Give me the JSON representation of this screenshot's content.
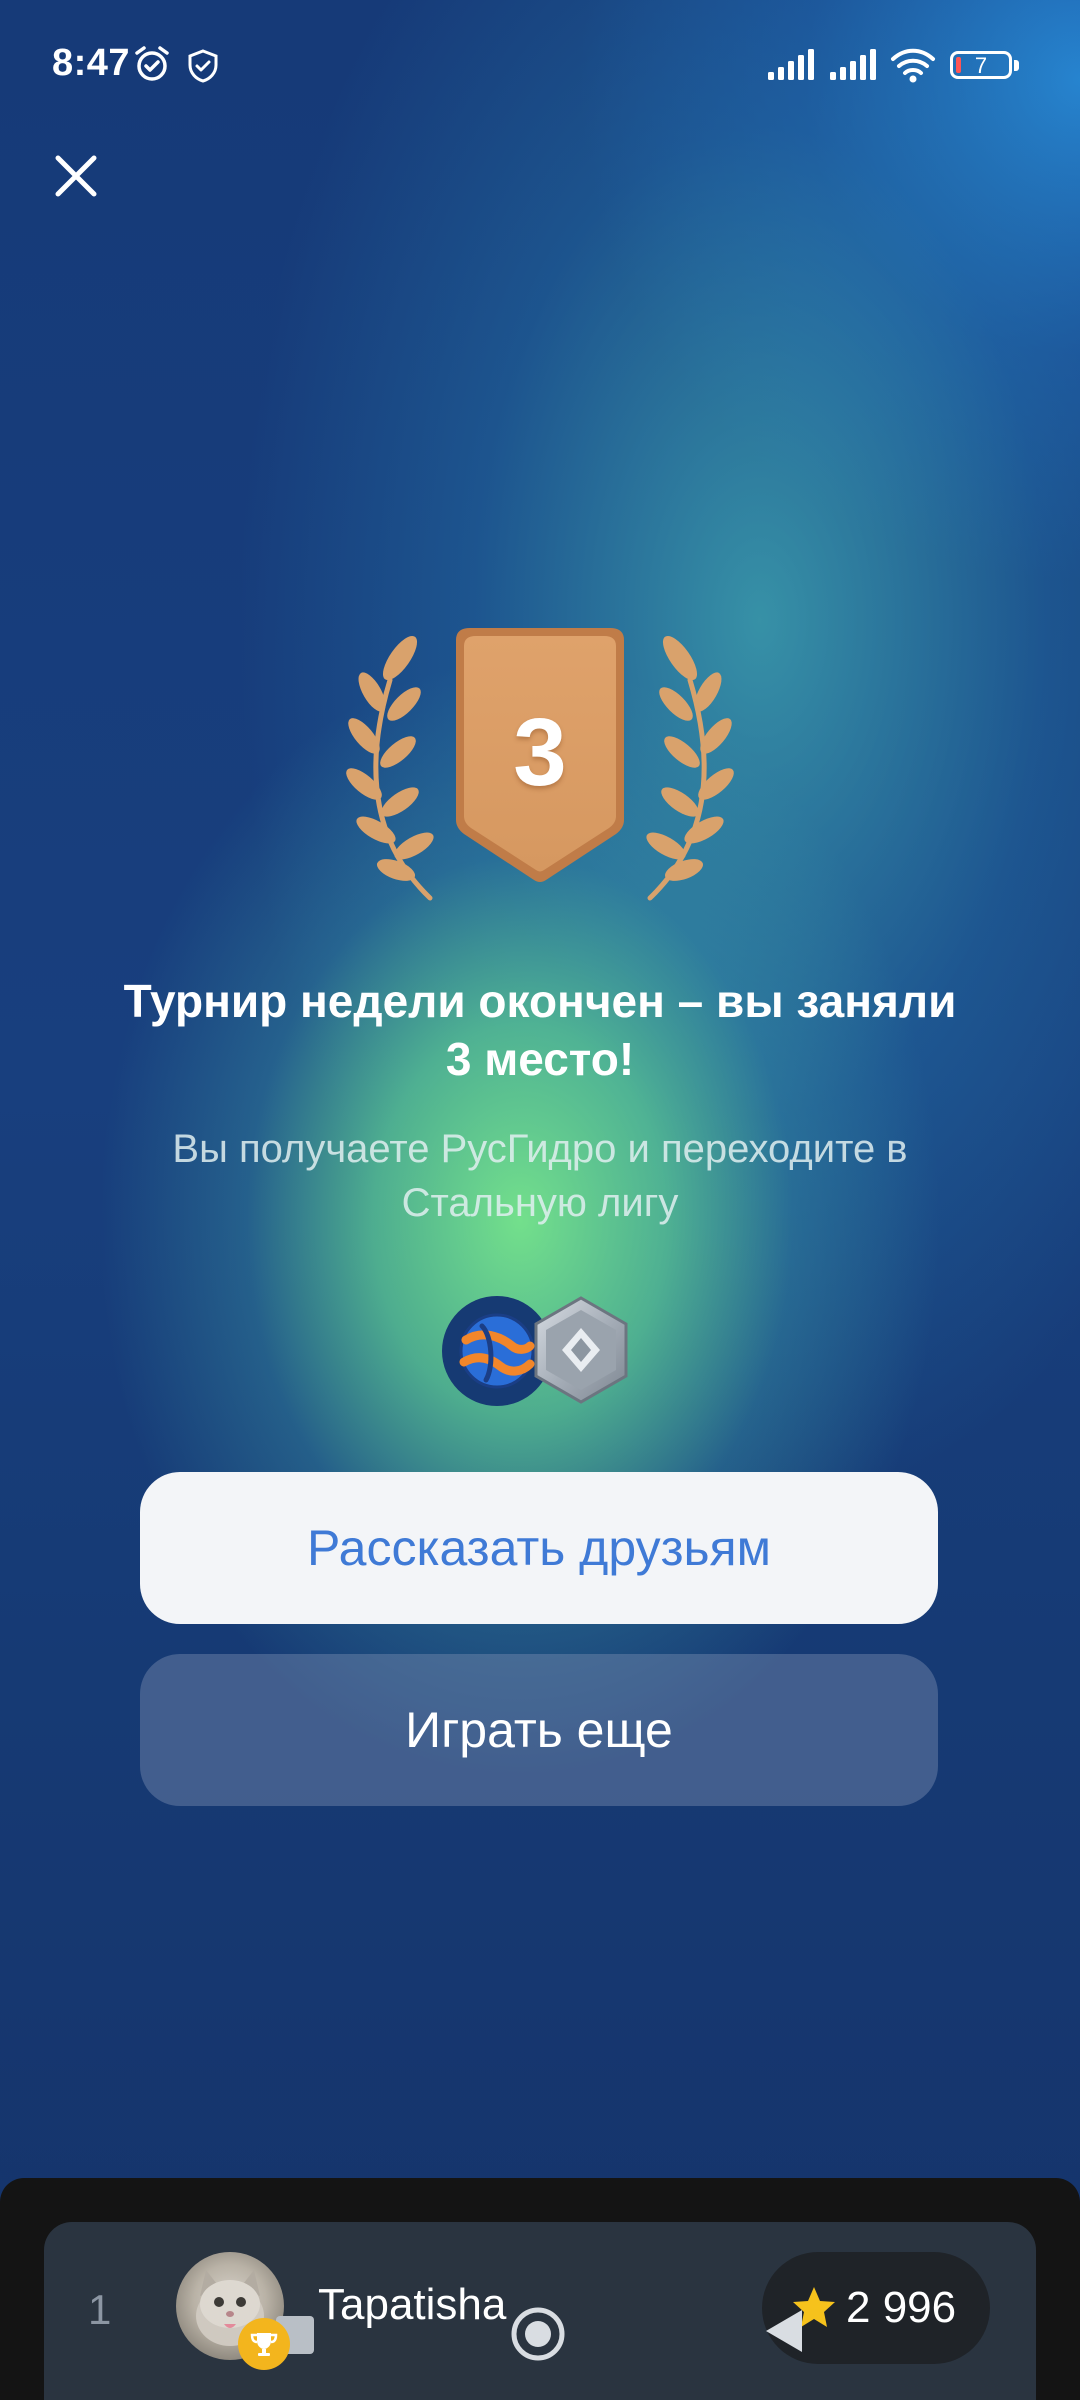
{
  "status_bar": {
    "time": "8:47",
    "battery_level": "7",
    "icons": [
      "alarm-icon",
      "shield-check-icon",
      "signal-icon",
      "signal-icon",
      "wifi-icon",
      "battery-icon"
    ]
  },
  "close_icon": "close-icon",
  "medal": {
    "place": "3",
    "colors": {
      "medal": "#d89a62",
      "laurel": "#d8a06a"
    }
  },
  "result": {
    "title": "Турнир недели окончен – вы заняли 3 место!",
    "subtitle": "Вы получаете РусГидро и переходите в Стальную лигу"
  },
  "rewards": {
    "icons": [
      "rushydro-logo-icon",
      "steel-league-icon"
    ]
  },
  "buttons": {
    "share": "Рассказать друзьям",
    "play_again": "Играть еще"
  },
  "leaderboard": {
    "rank": "1",
    "name": "Tapatisha",
    "score": "2 996",
    "badge_icon": "trophy-icon",
    "score_icon": "star-icon"
  },
  "navigation": {
    "icons": [
      "home-circle-icon",
      "back-triangle-icon"
    ]
  },
  "colors": {
    "accent_blue": "#3f7ad6",
    "gradient_green": "#78e88c",
    "background_blue": "#17346a"
  }
}
